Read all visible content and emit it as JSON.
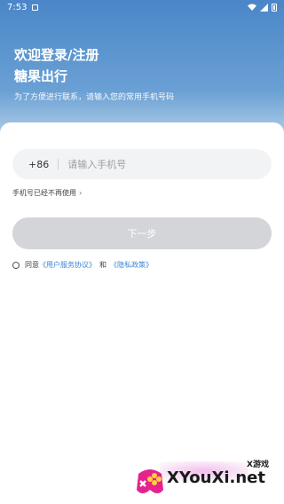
{
  "status_bar": {
    "time": "7:53"
  },
  "header": {
    "title_line1": "欢迎登录/注册",
    "title_line2": "糖果出行",
    "subtitle": "为了方便进行联系，请输入您的常用手机号码"
  },
  "phone_field": {
    "country_code": "+86",
    "placeholder": "请输入手机号",
    "value": ""
  },
  "unused_number_link": "手机号已经不再使用",
  "next_button": "下一步",
  "agreement": {
    "prefix": "同意",
    "user_agreement": "《用户服务协议》",
    "conjunction": "和",
    "privacy_policy": "《隐私政策》"
  },
  "watermark": {
    "cn": "X游戏",
    "en": "XYouXi.net"
  },
  "colors": {
    "header_blue": "#4a86c8",
    "link_blue": "#3a86d8",
    "button_disabled": "#d3d5d9",
    "input_bg": "#f2f3f5"
  }
}
